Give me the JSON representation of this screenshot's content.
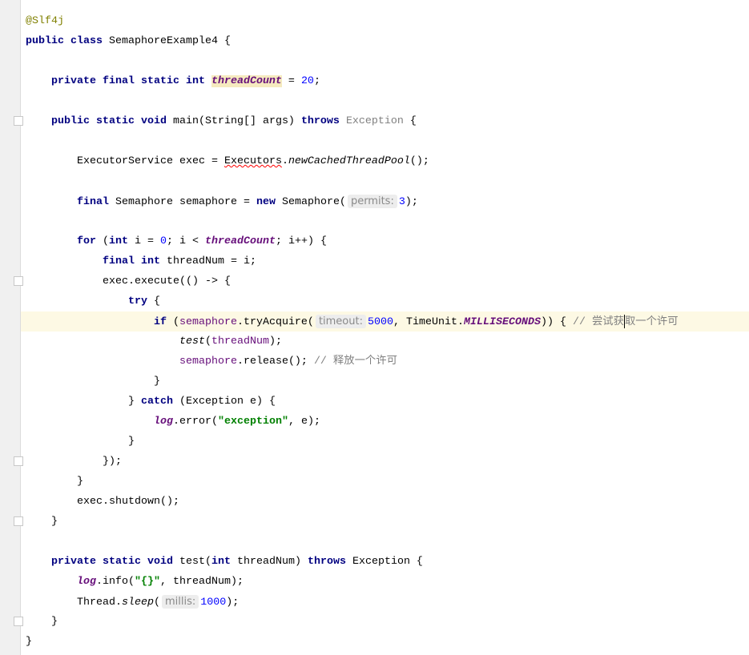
{
  "editor": {
    "colors": {
      "keyword": "#000080",
      "annotation": "#808000",
      "number": "#0000ff",
      "field": "#660e7a",
      "string": "#008000",
      "comment": "#808080",
      "current_line": "#fdf9e4"
    },
    "current_line_index": 15,
    "lines": [
      [
        [
          "@Slf4j",
          "ann"
        ]
      ],
      [
        [
          "public class ",
          "kw"
        ],
        [
          "SemaphoreExample4",
          ""
        ],
        [
          " {",
          ""
        ]
      ],
      [],
      [
        [
          "    private final static int ",
          "kw"
        ],
        [
          "threadCount",
          "fieldhl"
        ],
        [
          " = ",
          ""
        ],
        [
          "20",
          "num"
        ],
        [
          ";",
          ""
        ]
      ],
      [],
      [
        [
          "    public static void ",
          "kw"
        ],
        [
          "main(String[] args) ",
          ""
        ],
        [
          "throws ",
          "kw"
        ],
        [
          "Exception",
          "gray"
        ],
        [
          " {",
          ""
        ]
      ],
      [],
      [
        [
          "        ExecutorService exec = ",
          ""
        ],
        [
          "Executors",
          "err"
        ],
        [
          ".",
          ""
        ],
        [
          "newCachedThreadPool",
          "it"
        ],
        [
          "();",
          ""
        ]
      ],
      [],
      [
        [
          "        final ",
          "kw"
        ],
        [
          "Semaphore semaphore = ",
          ""
        ],
        [
          "new ",
          "kw"
        ],
        [
          "Semaphore(",
          ""
        ],
        [
          "permits:",
          "hint"
        ],
        [
          "3",
          "num"
        ],
        [
          ");",
          ""
        ]
      ],
      [],
      [
        [
          "        for ",
          "kw"
        ],
        [
          "(",
          ""
        ],
        [
          "int ",
          "kw"
        ],
        [
          "i = ",
          ""
        ],
        [
          "0",
          "num"
        ],
        [
          "; i < ",
          ""
        ],
        [
          "threadCount",
          "field"
        ],
        [
          "; i++) {",
          ""
        ]
      ],
      [
        [
          "            final int ",
          "kw"
        ],
        [
          "threadNum = i;",
          ""
        ]
      ],
      [
        [
          "            exec.execute(() -> {",
          ""
        ]
      ],
      [
        [
          "                try ",
          "kw"
        ],
        [
          "{",
          ""
        ]
      ],
      [
        [
          "                    if ",
          "kw"
        ],
        [
          "(",
          ""
        ],
        [
          "semaphore",
          "local"
        ],
        [
          ".tryAcquire(",
          ""
        ],
        [
          "timeout:",
          "hint"
        ],
        [
          "5000",
          "num"
        ],
        [
          ", TimeUnit.",
          ""
        ],
        [
          "MILLISECONDS",
          "field"
        ],
        [
          ")) { ",
          ""
        ],
        [
          "// 尝试获",
          "cm"
        ],
        [
          "",
          "caret"
        ],
        [
          "取一个许可",
          "cm"
        ]
      ],
      [
        [
          "                        ",
          ""
        ],
        [
          "test",
          "it"
        ],
        [
          "(",
          ""
        ],
        [
          "threadNum",
          "local"
        ],
        [
          ");",
          ""
        ]
      ],
      [
        [
          "                        ",
          ""
        ],
        [
          "semaphore",
          "local"
        ],
        [
          ".release(); ",
          ""
        ],
        [
          "// 释放一个许可",
          "cm"
        ]
      ],
      [
        [
          "                    }",
          ""
        ]
      ],
      [
        [
          "                } ",
          ""
        ],
        [
          "catch ",
          "kw"
        ],
        [
          "(Exception e) {",
          ""
        ]
      ],
      [
        [
          "                    ",
          ""
        ],
        [
          "log",
          "field"
        ],
        [
          ".error(",
          ""
        ],
        [
          "\"exception\"",
          "str"
        ],
        [
          ", e);",
          ""
        ]
      ],
      [
        [
          "                }",
          ""
        ]
      ],
      [
        [
          "            });",
          ""
        ]
      ],
      [
        [
          "        }",
          ""
        ]
      ],
      [
        [
          "        exec.shutdown();",
          ""
        ]
      ],
      [
        [
          "    }",
          ""
        ]
      ],
      [],
      [
        [
          "    private static void ",
          "kw"
        ],
        [
          "test(",
          ""
        ],
        [
          "int ",
          "kw"
        ],
        [
          "threadNum) ",
          ""
        ],
        [
          "throws ",
          "kw"
        ],
        [
          "Exception {",
          ""
        ]
      ],
      [
        [
          "        ",
          ""
        ],
        [
          "log",
          "field"
        ],
        [
          ".info(",
          ""
        ],
        [
          "\"{}\"",
          "str"
        ],
        [
          ", threadNum);",
          ""
        ]
      ],
      [
        [
          "        Thread.",
          ""
        ],
        [
          "sleep",
          "it"
        ],
        [
          "(",
          ""
        ],
        [
          "millis:",
          "hint"
        ],
        [
          "1000",
          "num"
        ],
        [
          ");",
          ""
        ]
      ],
      [
        [
          "    }",
          ""
        ]
      ],
      [
        [
          "}",
          ""
        ]
      ]
    ]
  }
}
